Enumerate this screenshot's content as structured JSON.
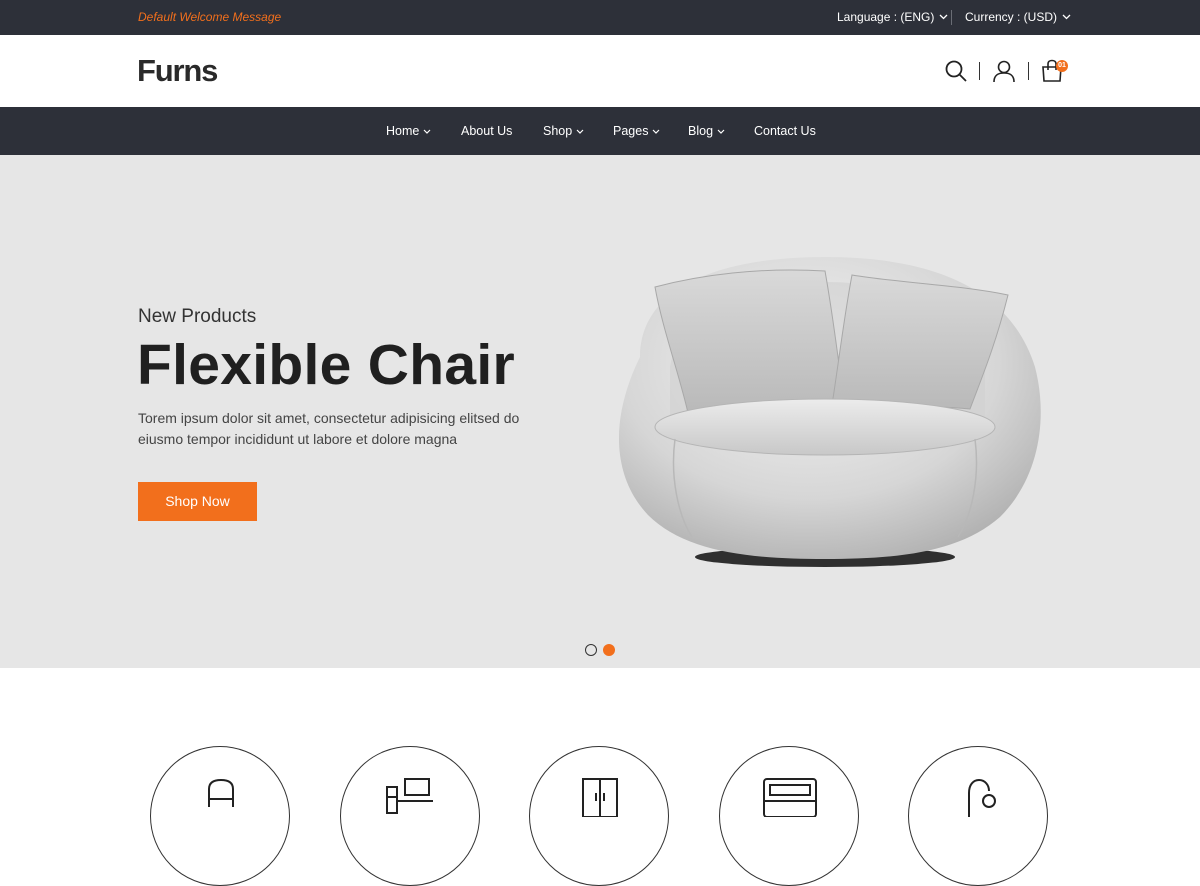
{
  "topbar": {
    "welcome": "Default Welcome Message",
    "language": "Language : (ENG)",
    "currency": "Currency : (USD)"
  },
  "header": {
    "logo": "Furns",
    "cart_count": "01",
    "icons": [
      "search-icon",
      "user-icon",
      "shopping-bag-icon"
    ]
  },
  "nav": {
    "items": [
      {
        "label": "Home",
        "dropdown": true
      },
      {
        "label": "About Us",
        "dropdown": false
      },
      {
        "label": "Shop",
        "dropdown": true
      },
      {
        "label": "Pages",
        "dropdown": true
      },
      {
        "label": "Blog",
        "dropdown": true
      },
      {
        "label": "Contact Us",
        "dropdown": false
      }
    ]
  },
  "hero": {
    "subtitle": "New Products",
    "title": "Flexible Chair",
    "text": "Torem ipsum dolor sit amet, consectetur adipisicing elitsed do eiusmo tempor incididunt ut labore et dolore magna",
    "button": "Shop Now",
    "slides": 2,
    "active_slide": 2
  },
  "categories": {
    "icons": [
      "chair-icon",
      "desk-icon",
      "wardrobe-icon",
      "cabinet-icon",
      "lamp-icon"
    ]
  },
  "colors": {
    "accent": "#f26f1c",
    "dark_bar": "#2d3039",
    "hero_bg": "#e6e6e6"
  }
}
